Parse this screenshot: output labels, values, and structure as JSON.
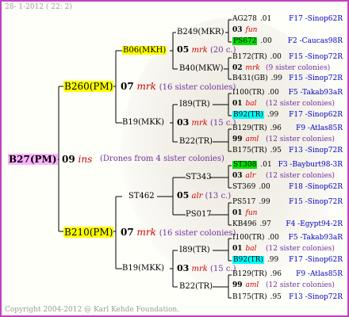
{
  "header": "28- 1-2012 ( 22: 2)",
  "footer": "Copyright 2004-2012 @ Karl Kehde Foundation.",
  "root": {
    "label": "B27(PM)",
    "num": "09",
    "ins": "ins",
    "drones": "(Drones from 4 sister colonies)"
  },
  "l1_top": {
    "label": "B260(PM)",
    "num": "07",
    "ins": "mrk",
    "note": "(16 sister colonies)"
  },
  "l1_bot": {
    "label": "B210(PM)",
    "num": "07",
    "ins": "mrk",
    "note": "(16 sister colonies)"
  },
  "l2": {
    "b06": {
      "label": "B06(MKH)",
      "num": "05",
      "ins": "mrk",
      "note": "(20 c.)"
    },
    "b19a": {
      "label": "B19(MKK)",
      "num": "03",
      "ins": "mrk",
      "note": "(15 c.)"
    },
    "st462": {
      "label": "ST462",
      "num": "05",
      "ins": "alr",
      "note": "(13 c.)"
    },
    "b19b": {
      "label": "B19(MKK)",
      "num": "03",
      "ins": "mrk",
      "note": "(15 c.)"
    }
  },
  "l3": [
    "B249(MKR)",
    "B40(MKW)",
    "I89(TR)",
    "B22(TR)",
    "ST343",
    "PS017",
    "I89(TR)",
    "B22(TR)"
  ],
  "rows": [
    {
      "id": "AG278",
      "mid": ".01",
      "right": "F17 -Sinop62R",
      "hl": ""
    },
    {
      "id": "03",
      "mid": "fun",
      "right": "",
      "hl": "",
      "kind": "ins"
    },
    {
      "id": "PS672",
      "mid": ".00",
      "right": "F2 -Caucas98R",
      "hl": "g"
    },
    {
      "id": "B172(TR)",
      "mid": ".00",
      "right": "F15 -Sinop72R",
      "hl": ""
    },
    {
      "id": "02",
      "mid": "mrk",
      "right": "(9 sister colonies)",
      "hl": "",
      "kind": "ins"
    },
    {
      "id": "B431(GB)",
      "mid": ".99",
      "right": "F15 -Sinop72R",
      "hl": ""
    },
    {
      "id": "I100(TR)",
      "mid": ".00",
      "right": "F5 -Takab93aR",
      "hl": ""
    },
    {
      "id": "01",
      "mid": "bal",
      "right": "(12 sister colonies)",
      "hl": "",
      "kind": "ins"
    },
    {
      "id": "B92(TR)",
      "mid": ".99",
      "right": "F17 -Sinop62R",
      "hl": "c"
    },
    {
      "id": "B129(TR)",
      "mid": ".96",
      "right": "F9 -Atlas85R",
      "hl": ""
    },
    {
      "id": "99",
      "mid": "aml",
      "right": "(12 sister colonies)",
      "hl": "",
      "kind": "ins"
    },
    {
      "id": "B175(TR)",
      "mid": ".95",
      "right": "F13 -Sinop72R",
      "hl": ""
    },
    {
      "id": "ST308",
      "mid": ".01",
      "right": "F3 -Bayburt98-3R",
      "hl": "g"
    },
    {
      "id": "03",
      "mid": "alr",
      "right": "(12 sister colonies)",
      "hl": "",
      "kind": "ins"
    },
    {
      "id": "ST369",
      "mid": ".00",
      "right": "F18 -Sinop62R",
      "hl": ""
    },
    {
      "id": "PS517",
      "mid": ".99",
      "right": "F15 -Sinop72R",
      "hl": ""
    },
    {
      "id": "01",
      "mid": "fun",
      "right": "",
      "hl": "",
      "kind": "ins"
    },
    {
      "id": "KB496",
      "mid": ".97",
      "right": "F4 -Egypt94-2R",
      "hl": ""
    },
    {
      "id": "I100(TR)",
      "mid": ".00",
      "right": "F5 -Takab93aR",
      "hl": ""
    },
    {
      "id": "01",
      "mid": "bal",
      "right": "(12 sister colonies)",
      "hl": "",
      "kind": "ins"
    },
    {
      "id": "B92(TR)",
      "mid": ".99",
      "right": "F17 -Sinop62R",
      "hl": "c"
    },
    {
      "id": "B129(TR)",
      "mid": ".96",
      "right": "F9 -Atlas85R",
      "hl": ""
    },
    {
      "id": "99",
      "mid": "aml",
      "right": "(12 sister colonies)",
      "hl": "",
      "kind": "ins"
    },
    {
      "id": "B175(TR)",
      "mid": ".95",
      "right": "F13 -Sinop72R",
      "hl": ""
    }
  ]
}
